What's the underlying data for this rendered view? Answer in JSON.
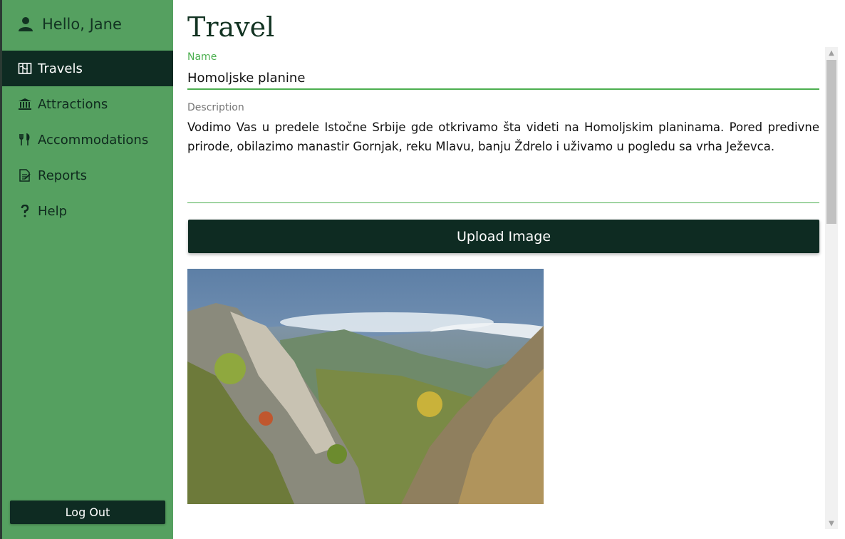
{
  "theme": {
    "sidebar_bg": "#55a060",
    "active_bg": "#0e2b22",
    "accent": "#4caf50",
    "text_dark": "#123322"
  },
  "user": {
    "greeting": "Hello, Jane",
    "icon": "user-icon"
  },
  "sidebar": {
    "items": [
      {
        "label": "Travels",
        "icon": "map-icon",
        "active": true
      },
      {
        "label": "Attractions",
        "icon": "landmark-icon",
        "active": false
      },
      {
        "label": "Accommodations",
        "icon": "utensils-icon",
        "active": false
      },
      {
        "label": "Reports",
        "icon": "report-icon",
        "active": false
      },
      {
        "label": "Help",
        "icon": "question-icon",
        "active": false
      }
    ],
    "logout_label": "Log Out"
  },
  "main": {
    "title": "Travel",
    "name_label": "Name",
    "name_value": "Homoljske planine",
    "description_label": "Description",
    "description_value": "Vodimo Vas u predele Istočne Srbije gde otkrivamo šta videti na Homoljskim planinama. Pored predivne prirode, obilazimo manastir Gornjak, reku Mlavu, banju Ždrelo i uživamo u pogledu sa vrha Ježevca.",
    "upload_label": "Upload Image",
    "image_subject": "mountain-landscape-photo"
  }
}
